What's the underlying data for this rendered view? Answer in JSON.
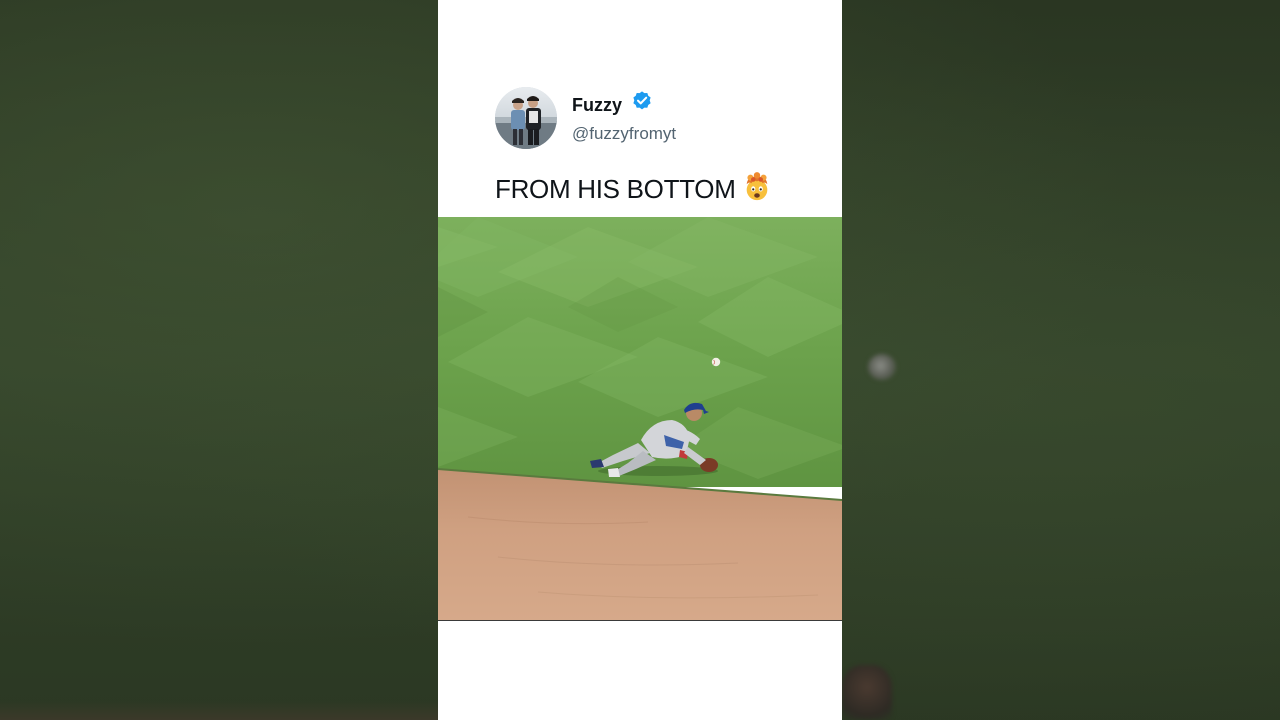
{
  "author": {
    "name": "Fuzzy",
    "handle": "@fuzzyfromyt",
    "verified": true,
    "verified_icon": "verified-badge-icon",
    "verified_color": "#1d9bf0",
    "avatar_icon": "profile-photo-two-people"
  },
  "tweet": {
    "text": "FROM HIS BOTTOM",
    "emoji_icon": "exploding-head-emoji"
  },
  "media": {
    "kind": "video-frame",
    "scene": "baseball-infielder-sliding-throw"
  },
  "colors": {
    "card_background": "#ffffff",
    "name_color": "#0f1419",
    "handle_color": "#536471",
    "grass": "#6aa04a",
    "infield_dirt": "#c99a78"
  }
}
